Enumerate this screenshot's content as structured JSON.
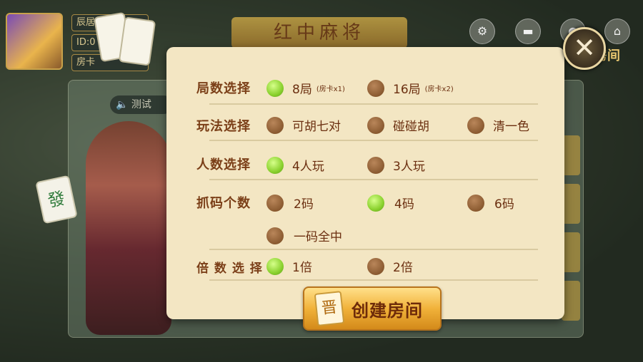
{
  "header": {
    "room_label": "房间",
    "id_prefix": "ID:0",
    "card_prefix": "房卡",
    "name_prefix": "辰居",
    "title": "红中麻将",
    "test_label": "测试"
  },
  "icons": {
    "settings": "gear-icon",
    "mail": "mail-icon",
    "info": "info-icon",
    "home": "home-icon",
    "close": "close-icon"
  },
  "dialog": {
    "rounds": {
      "label": "局数选择",
      "options": [
        {
          "text": "8局",
          "note": "(房卡x1)",
          "selected": true
        },
        {
          "text": "16局",
          "note": "(房卡x2)",
          "selected": false
        }
      ]
    },
    "play": {
      "label": "玩法选择",
      "options": [
        {
          "text": "可胡七对",
          "selected": false
        },
        {
          "text": "碰碰胡",
          "selected": false
        },
        {
          "text": "清一色",
          "selected": false
        }
      ]
    },
    "players": {
      "label": "人数选择",
      "options": [
        {
          "text": "4人玩",
          "selected": true
        },
        {
          "text": "3人玩",
          "selected": false
        }
      ]
    },
    "birds": {
      "label": "抓码个数",
      "options": [
        {
          "text": "2码",
          "selected": false
        },
        {
          "text": "4码",
          "selected": true
        },
        {
          "text": "6码",
          "selected": false
        },
        {
          "text": "一码全中",
          "selected": false
        }
      ]
    },
    "multiplier": {
      "label": "倍 数 选 择",
      "options": [
        {
          "text": "1倍",
          "selected": true
        },
        {
          "text": "2倍",
          "selected": false
        }
      ]
    },
    "create_button": "创建房间",
    "button_tile_char": "晋"
  },
  "colors": {
    "dialog_bg": "#f3e6c3",
    "label_color": "#7b3f18",
    "selected_radio": "#8ad12e",
    "unselected_radio": "#8a5a30"
  }
}
